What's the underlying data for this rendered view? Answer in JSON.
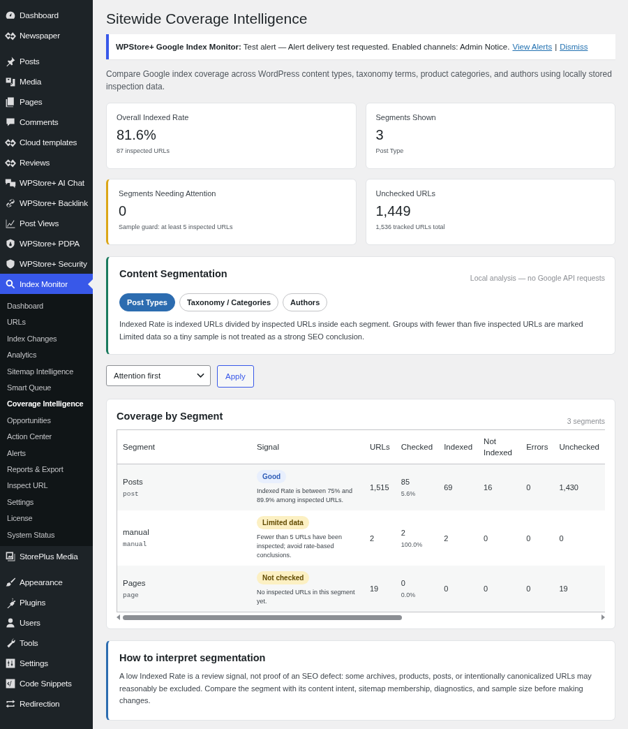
{
  "sidebar": {
    "groups": [
      [
        {
          "label": "Dashboard",
          "selected": false
        },
        {
          "label": "Newspaper",
          "selected": false
        }
      ],
      [
        {
          "label": "Posts",
          "selected": false
        },
        {
          "label": "Media",
          "selected": false
        },
        {
          "label": "Pages",
          "selected": false
        },
        {
          "label": "Comments",
          "selected": false
        },
        {
          "label": "Cloud templates",
          "selected": false
        },
        {
          "label": "Reviews",
          "selected": false
        },
        {
          "label": "WPStore+ AI Chat",
          "selected": false
        },
        {
          "label": "WPStore+ Backlink",
          "selected": false
        },
        {
          "label": "Post Views",
          "selected": false
        },
        {
          "label": "WPStore+ PDPA",
          "selected": false
        },
        {
          "label": "WPStore+ Security",
          "selected": false
        },
        {
          "label": "Index Monitor",
          "selected": true,
          "children": [
            {
              "label": "Dashboard",
              "selected": false
            },
            {
              "label": "URLs",
              "selected": false
            },
            {
              "label": "Index Changes",
              "selected": false
            },
            {
              "label": "Analytics",
              "selected": false
            },
            {
              "label": "Sitemap Intelligence",
              "selected": false
            },
            {
              "label": "Smart Queue",
              "selected": false
            },
            {
              "label": "Coverage Intelligence",
              "selected": true
            },
            {
              "label": "Opportunities",
              "selected": false
            },
            {
              "label": "Action Center",
              "selected": false
            },
            {
              "label": "Alerts",
              "selected": false
            },
            {
              "label": "Reports & Export",
              "selected": false
            },
            {
              "label": "Inspect URL",
              "selected": false
            },
            {
              "label": "Settings",
              "selected": false
            },
            {
              "label": "License",
              "selected": false
            },
            {
              "label": "System Status",
              "selected": false
            }
          ]
        },
        {
          "label": "StorePlus Media",
          "selected": false
        }
      ],
      [
        {
          "label": "Appearance",
          "selected": false
        },
        {
          "label": "Plugins",
          "selected": false
        },
        {
          "label": "Users",
          "selected": false
        },
        {
          "label": "Tools",
          "selected": false
        },
        {
          "label": "Settings",
          "selected": false
        },
        {
          "label": "Code Snippets",
          "selected": false
        },
        {
          "label": "Redirection",
          "selected": false
        }
      ]
    ]
  },
  "page_title": "Sitewide Coverage Intelligence",
  "notice": {
    "message": "**WPStore+ Google Index Monitor:** Test alert — Alert delivery test requested. Enabled channels: Admin Notice.",
    "links": [
      "View Alerts",
      "Dismiss"
    ],
    "separator": "|"
  },
  "description": "Compare Google index coverage across WordPress content types, taxonomy terms, product categories, and authors using locally stored inspection data.",
  "stats": [
    {
      "label": "Overall Indexed Rate",
      "value": "81.6%",
      "note": "87 inspected URLs",
      "kind": "plain"
    },
    {
      "label": "Segments Shown",
      "value": "3",
      "note": "Post Type",
      "kind": "plain"
    },
    {
      "label": "Segments Needing Attention",
      "value": "0",
      "note": "Sample guard: at least 5 inspected URLs",
      "kind": "warning"
    },
    {
      "label": "Unchecked URLs",
      "value": "1,449",
      "note": "1,536 tracked URLs total",
      "kind": "plain"
    }
  ],
  "segmentation": {
    "title": "Content Segmentation",
    "note": "Local analysis — no Google API requests",
    "tabs": [
      {
        "label": "Post Types",
        "selected": true
      },
      {
        "label": "Taxonomy / Categories",
        "selected": false
      },
      {
        "label": "Authors",
        "selected": false
      }
    ],
    "text": "Indexed Rate is indexed URLs divided by inspected URLs inside each segment. Groups with fewer than five inspected URLs are marked Limited data so a tiny sample is not treated as a strong SEO conclusion."
  },
  "sort": {
    "value": "Attention first",
    "button": "Apply"
  },
  "coverage": {
    "title": "Coverage by Segment",
    "count": "3 segments",
    "columns": [
      "Segment",
      "Signal",
      "URLs",
      "Checked",
      "Indexed",
      "Not Indexed",
      "Errors",
      "Unchecked"
    ],
    "rows": [
      {
        "name": "Posts",
        "slug": "post",
        "signal": "Good",
        "color": "#e8effd",
        "signal_note": "Indexed Rate is between 75% and 89.9% among inspected URLs.",
        "urls": "1,515",
        "checked": "85",
        "checked_pct": "5.6%",
        "indexed": "69",
        "not_indexed": "16",
        "errors": "0",
        "unchecked": "1,430"
      },
      {
        "name": "manual",
        "slug": "manual",
        "signal": "Limited data",
        "color": "#fcf0c3",
        "signal_note": "Fewer than 5 URLs have been inspected; avoid rate-based conclusions.",
        "urls": "2",
        "checked": "2",
        "checked_pct": "100.0%",
        "indexed": "2",
        "not_indexed": "0",
        "errors": "0",
        "unchecked": "0"
      },
      {
        "name": "Pages",
        "slug": "page",
        "signal": "Not checked",
        "color": "#fcf0c3",
        "signal_note": "No inspected URLs in this segment yet.",
        "urls": "19",
        "checked": "0",
        "checked_pct": "0.0%",
        "indexed": "0",
        "not_indexed": "0",
        "errors": "0",
        "unchecked": "19"
      }
    ]
  },
  "help": {
    "title": "How to interpret segmentation",
    "text": "A low Indexed Rate is a review signal, not proof of an SEO defect: some archives, products, posts, or intentionally canonicalized URLs may reasonably be excluded. Compare the segment with its content intent, sitemap membership, diagnostics, and sample size before making changes."
  }
}
